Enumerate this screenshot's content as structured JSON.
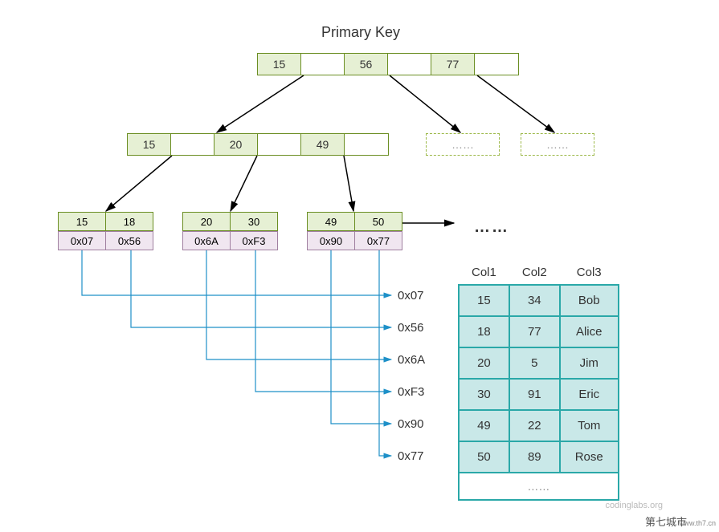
{
  "title": "Primary Key",
  "root_node": {
    "keys": [
      "15",
      "56",
      "77"
    ]
  },
  "level2_node": {
    "keys": [
      "15",
      "20",
      "49"
    ]
  },
  "dashed_placeholder": "……",
  "leaves": [
    {
      "keys": [
        "15",
        "18"
      ],
      "addrs": [
        "0x07",
        "0x56"
      ]
    },
    {
      "keys": [
        "20",
        "30"
      ],
      "addrs": [
        "0x6A",
        "0xF3"
      ]
    },
    {
      "keys": [
        "49",
        "50"
      ],
      "addrs": [
        "0x90",
        "0x77"
      ]
    }
  ],
  "ellipsis": "……",
  "pointer_labels": [
    "0x07",
    "0x56",
    "0x6A",
    "0xF3",
    "0x90",
    "0x77"
  ],
  "table": {
    "headers": [
      "Col1",
      "Col2",
      "Col3"
    ],
    "rows": [
      [
        "15",
        "34",
        "Bob"
      ],
      [
        "18",
        "77",
        "Alice"
      ],
      [
        "20",
        "5",
        "Jim"
      ],
      [
        "30",
        "91",
        "Eric"
      ],
      [
        "49",
        "22",
        "Tom"
      ],
      [
        "50",
        "89",
        "Rose"
      ]
    ],
    "footer": "……"
  },
  "attribution": "codinglabs.org",
  "footer": {
    "cn": "第七城市",
    "en": "www.th7.cn"
  }
}
